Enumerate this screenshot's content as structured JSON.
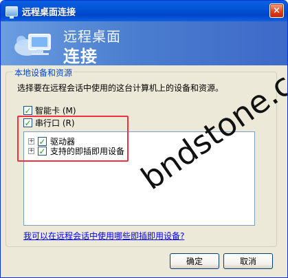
{
  "window": {
    "title": "远程桌面连接",
    "close": "×"
  },
  "banner": {
    "title": "远程桌面",
    "subtitle": "连接"
  },
  "group": {
    "label": "本地设备和资源",
    "description": "选择要在远程会话中使用的这台计算机上的设备和资源。"
  },
  "devices": {
    "smartcard": {
      "label": "智能卡 (M)",
      "checked": true
    },
    "serial": {
      "label": "串行口 (R)",
      "checked": true
    },
    "drives": {
      "label": "驱动器",
      "checked": true
    },
    "plug_play": {
      "label": "支持的即插即用设备",
      "checked": true
    }
  },
  "link": {
    "help": "我可以在远程会话中使用哪些即插即用设备?"
  },
  "buttons": {
    "ok": "确定",
    "cancel": "取消"
  },
  "watermark": {
    "text": "bndstone.com"
  }
}
